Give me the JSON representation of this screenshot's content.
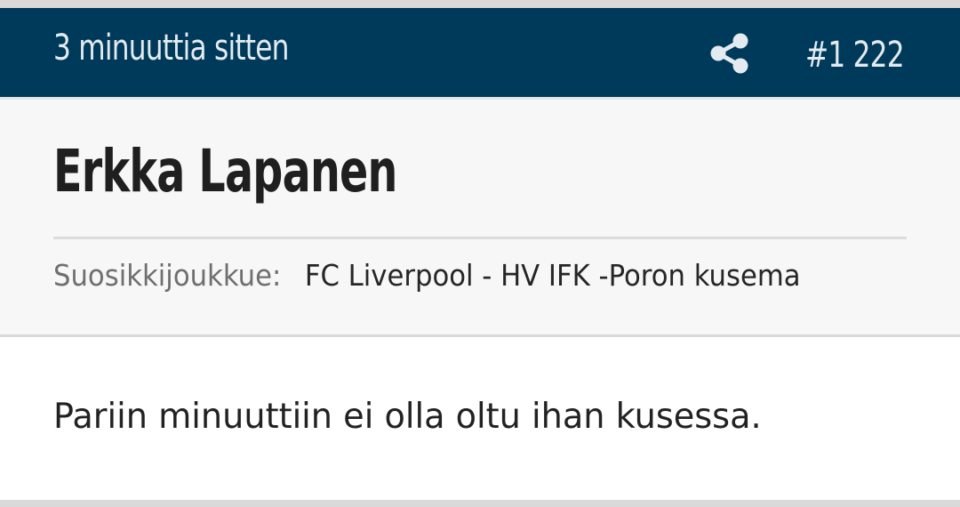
{
  "post": {
    "timestamp": "3 minuuttia sitten",
    "number": "#1 222",
    "author": "Erkka Lapanen",
    "favorite_team_label": "Suosikkijoukkue:",
    "favorite_team_value": "FC Liverpool - HV IFK -Poron kusema",
    "message": "Pariin minuuttiin ei olla oltu ihan kusessa."
  },
  "icons": {
    "share": "share-icon"
  },
  "colors": {
    "header_background": "#003a5a",
    "header_text": "#e3ebf0",
    "panel_background": "#f7f7f7",
    "body_background": "#ffffff"
  }
}
